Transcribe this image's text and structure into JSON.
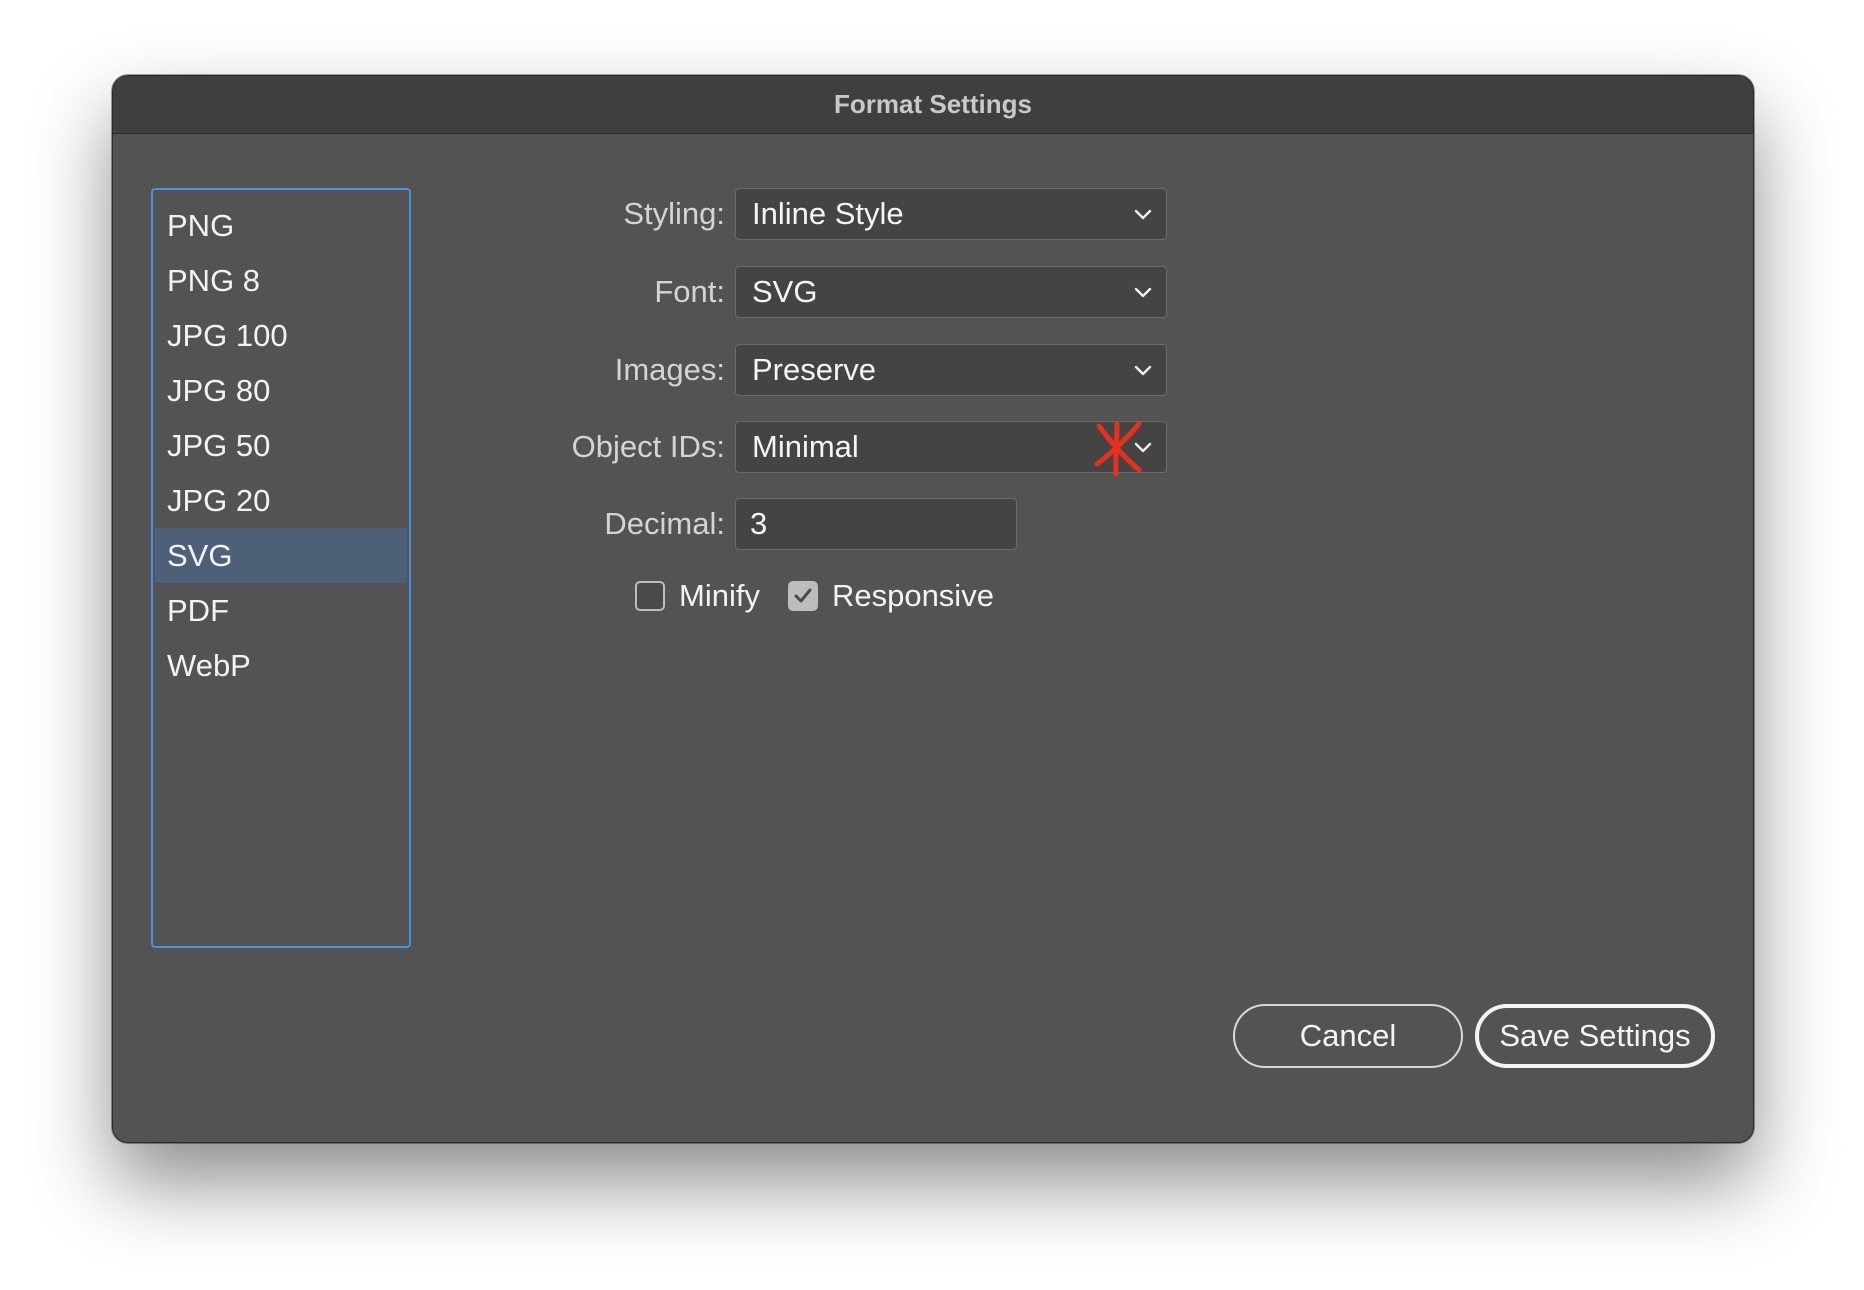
{
  "window": {
    "title": "Format Settings"
  },
  "formats": {
    "items": [
      "PNG",
      "PNG 8",
      "JPG 100",
      "JPG 80",
      "JPG 50",
      "JPG 20",
      "SVG",
      "PDF",
      "WebP"
    ],
    "selected": "SVG"
  },
  "settings": {
    "styling": {
      "label": "Styling:",
      "value": "Inline Style"
    },
    "font": {
      "label": "Font:",
      "value": "SVG"
    },
    "images": {
      "label": "Images:",
      "value": "Preserve"
    },
    "object_ids": {
      "label": "Object IDs:",
      "value": "Minimal"
    },
    "decimal": {
      "label": "Decimal:",
      "value": "3"
    },
    "minify": {
      "label": "Minify",
      "checked": false
    },
    "responsive": {
      "label": "Responsive",
      "checked": true
    }
  },
  "buttons": {
    "cancel": "Cancel",
    "save": "Save Settings"
  },
  "colors": {
    "dialog_bg": "#535353",
    "titlebar_bg": "#3f3f3f",
    "list_border": "#4a90e2",
    "selected_bg": "#4d6078",
    "annotation": "#e8301c"
  },
  "icons": {
    "dropdown": "chevron-down-icon",
    "annotation": "red-x-mark-icon",
    "check": "checkmark-icon"
  }
}
